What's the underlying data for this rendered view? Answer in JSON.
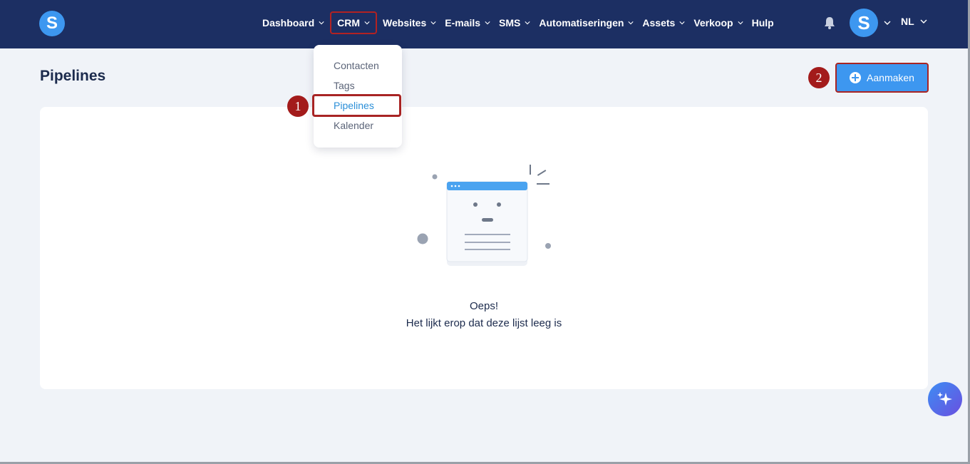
{
  "logo": {
    "letter": "S"
  },
  "nav": {
    "items": [
      {
        "label": "Dashboard",
        "has_dropdown": true
      },
      {
        "label": "CRM",
        "has_dropdown": true
      },
      {
        "label": "Websites",
        "has_dropdown": true
      },
      {
        "label": "E-mails",
        "has_dropdown": true
      },
      {
        "label": "SMS",
        "has_dropdown": true
      },
      {
        "label": "Automatiseringen",
        "has_dropdown": true
      },
      {
        "label": "Assets",
        "has_dropdown": true
      },
      {
        "label": "Verkoop",
        "has_dropdown": true
      },
      {
        "label": "Hulp",
        "has_dropdown": false
      }
    ],
    "avatar_letter": "S",
    "language": "NL"
  },
  "crm_menu": {
    "items": [
      {
        "label": "Contacten"
      },
      {
        "label": "Tags"
      },
      {
        "label": "Pipelines",
        "active": true
      },
      {
        "label": "Kalender"
      }
    ]
  },
  "page": {
    "title": "Pipelines",
    "create_button": "Aanmaken"
  },
  "empty_state": {
    "title": "Oeps!",
    "message": "Het lijkt erop dat deze lijst leeg is"
  },
  "annotations": {
    "step1": "1",
    "step2": "2"
  },
  "colors": {
    "topbar": "#1c2f63",
    "accent": "#3d97f0",
    "highlight_border": "#a82424",
    "active_menu": "#2b8fd8"
  }
}
